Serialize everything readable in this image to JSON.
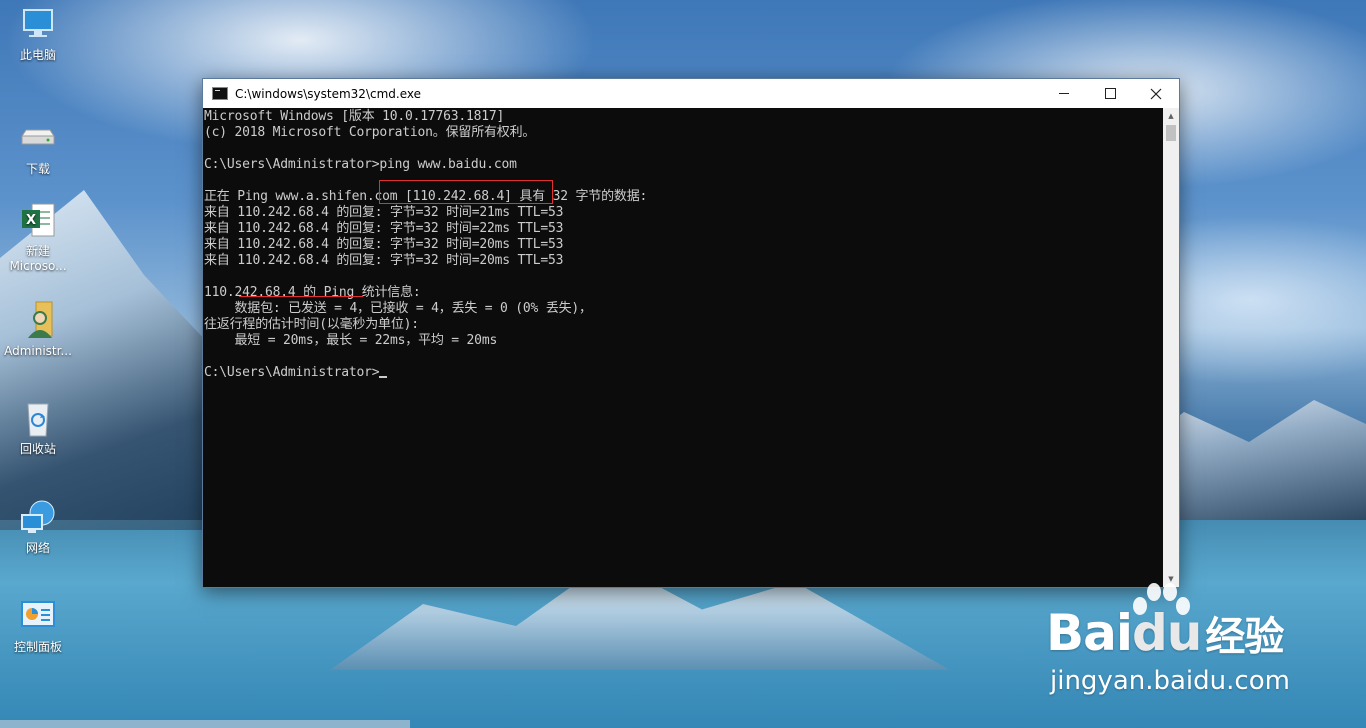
{
  "desktop": {
    "icons": [
      {
        "label": "此电脑",
        "icon": "computer-icon"
      },
      {
        "label": "下载",
        "icon": "download-drive-icon"
      },
      {
        "label": "新建\nMicroso...",
        "icon": "excel-file-icon"
      },
      {
        "label": "Administr...",
        "icon": "user-folder-icon"
      },
      {
        "label": "回收站",
        "icon": "recycle-bin-icon"
      },
      {
        "label": "网络",
        "icon": "network-icon"
      },
      {
        "label": "控制面板",
        "icon": "control-panel-icon"
      }
    ]
  },
  "window": {
    "title": "C:\\windows\\system32\\cmd.exe",
    "buttons": {
      "minimize": "minimize",
      "maximize": "maximize",
      "close": "close"
    }
  },
  "console": {
    "lines": [
      "Microsoft Windows [版本 10.0.17763.1817]",
      "(c) 2018 Microsoft Corporation。保留所有权利。",
      "",
      "C:\\Users\\Administrator>ping www.baidu.com",
      "",
      "正在 Ping www.a.shifen.com [110.242.68.4] 具有 32 字节的数据:",
      "来自 110.242.68.4 的回复: 字节=32 时间=21ms TTL=53",
      "来自 110.242.68.4 的回复: 字节=32 时间=22ms TTL=53",
      "来自 110.242.68.4 的回复: 字节=32 时间=20ms TTL=53",
      "来自 110.242.68.4 的回复: 字节=32 时间=20ms TTL=53",
      "",
      "110.242.68.4 的 Ping 统计信息:",
      "    数据包: 已发送 = 4，已接收 = 4，丢失 = 0 (0% 丢失)，",
      "往返行程的估计时间(以毫秒为单位):",
      "    最短 = 20ms，最长 = 22ms，平均 = 20ms",
      "",
      "C:\\Users\\Administrator>"
    ]
  },
  "watermark": {
    "brand_bai": "Bai",
    "brand_du": "du",
    "brand_cn": "经验",
    "site": "jingyan.baidu.com"
  },
  "colors": {
    "console_bg": "#0c0c0c",
    "console_text": "#cccccc",
    "annotation_red": "#e03030"
  }
}
